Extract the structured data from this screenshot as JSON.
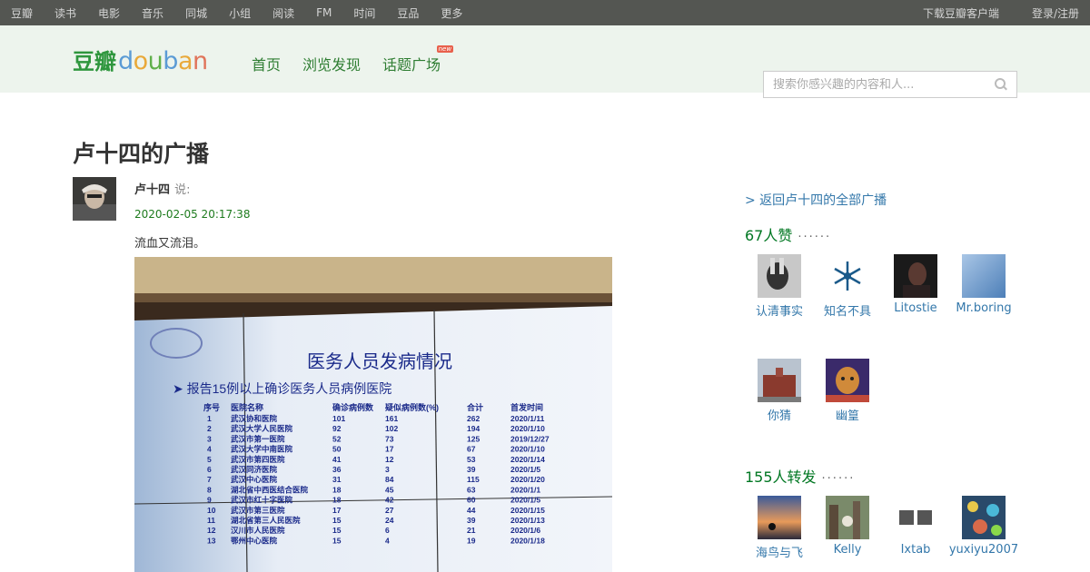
{
  "global_nav": {
    "left": [
      "豆瓣",
      "读书",
      "电影",
      "音乐",
      "同城",
      "小组",
      "阅读",
      "FM",
      "时间",
      "豆品",
      "更多"
    ],
    "right": [
      "下载豆瓣客户端",
      "登录/注册"
    ]
  },
  "header": {
    "logo_cn": "豆瓣",
    "logo_en": "douban",
    "nav": [
      "首页",
      "浏览发现",
      "话题广场"
    ],
    "new_badge": "new",
    "search_placeholder": "搜索你感兴趣的内容和人..."
  },
  "page": {
    "title": "卢十四的广播",
    "author": "卢十四",
    "say": "说:",
    "time": "2020-02-05 20:17:38",
    "text": "流血又流泪。",
    "image_table": {
      "title": "医务人员发病情况",
      "subtitle": "➤ 报告15例以上确诊医务人员病例医院",
      "headers": [
        "序号",
        "医院名称",
        "确诊病例数",
        "疑似病例数(%)",
        "合计",
        "首发时间"
      ],
      "rows": [
        [
          "1",
          "武汉协和医院",
          "101",
          "161",
          "262",
          "2020/1/11"
        ],
        [
          "2",
          "武汉大学人民医院",
          "92",
          "102",
          "194",
          "2020/1/10"
        ],
        [
          "3",
          "武汉市第一医院",
          "52",
          "73",
          "125",
          "2019/12/27"
        ],
        [
          "4",
          "武汉大学中南医院",
          "50",
          "17",
          "67",
          "2020/1/10"
        ],
        [
          "5",
          "武汉市第四医院",
          "41",
          "12",
          "53",
          "2020/1/14"
        ],
        [
          "6",
          "武汉同济医院",
          "36",
          "3",
          "39",
          "2020/1/5"
        ],
        [
          "7",
          "武汉中心医院",
          "31",
          "84",
          "115",
          "2020/1/20"
        ],
        [
          "8",
          "湖北省中西医结合医院",
          "18",
          "45",
          "63",
          "2020/1/1"
        ],
        [
          "9",
          "武汉市红十字医院",
          "18",
          "42",
          "60",
          "2020/1/5"
        ],
        [
          "10",
          "武汉市第三医院",
          "17",
          "27",
          "44",
          "2020/1/15"
        ],
        [
          "11",
          "湖北省第三人民医院",
          "15",
          "24",
          "39",
          "2020/1/13"
        ],
        [
          "12",
          "汉川市人民医院",
          "15",
          "6",
          "21",
          "2020/1/6"
        ],
        [
          "13",
          "鄂州中心医院",
          "15",
          "4",
          "19",
          "2020/1/18"
        ]
      ]
    }
  },
  "sidebar": {
    "back_link": "> 返回卢十四的全部广播",
    "likes_title": "67人赞",
    "dots": "······",
    "likes": [
      "认清事实",
      "知名不具",
      "Litostie",
      "Mr.boring",
      "你猜",
      "幽篁"
    ],
    "reshares_title": "155人转发",
    "reshares": [
      "海鸟与飞",
      "Kelly",
      "Ixtab",
      "yuxiyu2007"
    ]
  }
}
